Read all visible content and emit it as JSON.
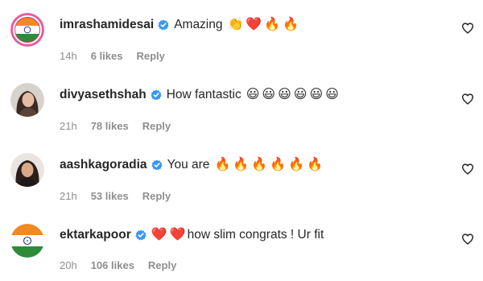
{
  "comments": [
    {
      "username": "imrashamidesai",
      "text": "Amazing",
      "emojis": [
        "👏",
        "❤️",
        "🔥",
        "🔥"
      ],
      "time": "14h",
      "likes": "6 likes",
      "reply": "Reply",
      "avatar": "india-flag-ring"
    },
    {
      "username": "divyasethshah",
      "text": "How fantastic",
      "emojis": [
        "😃",
        "😃",
        "😃",
        "😃",
        "😃",
        "😃"
      ],
      "time": "21h",
      "likes": "78 likes",
      "reply": "Reply",
      "avatar": "profile-photo"
    },
    {
      "username": "aashkagoradia",
      "text": "You are",
      "emojis": [
        "🔥",
        "🔥",
        "🔥",
        "🔥",
        "🔥",
        "🔥"
      ],
      "time": "21h",
      "likes": "53 likes",
      "reply": "Reply",
      "avatar": "profile-photo"
    },
    {
      "username": "ektarkapoor",
      "text": "how slim congrats ! Ur fit",
      "emojis_before": [
        "❤️",
        "❤️"
      ],
      "time": "20h",
      "likes": "106 likes",
      "reply": "Reply",
      "avatar": "india-flag"
    }
  ],
  "colors": {
    "verified": "#3897f0",
    "meta": "#8e8e8e",
    "text": "#262626",
    "heart_outline": "#262626"
  },
  "icons": {
    "verified": "verified-badge-icon",
    "like": "heart-outline-icon"
  }
}
